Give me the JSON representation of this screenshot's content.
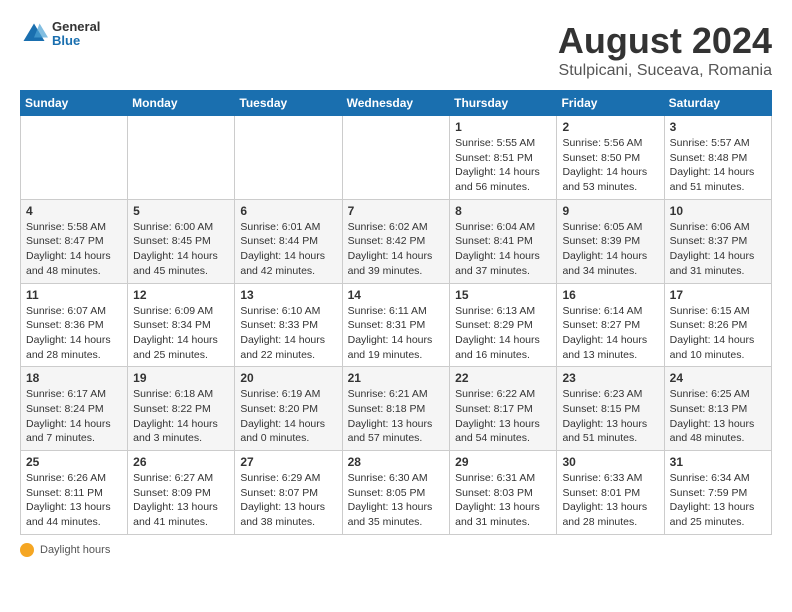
{
  "header": {
    "logo": {
      "general": "General",
      "blue": "Blue"
    },
    "title": "August 2024",
    "location": "Stulpicani, Suceava, Romania"
  },
  "calendar": {
    "weekdays": [
      "Sunday",
      "Monday",
      "Tuesday",
      "Wednesday",
      "Thursday",
      "Friday",
      "Saturday"
    ],
    "weeks": [
      [
        {
          "day": "",
          "info": ""
        },
        {
          "day": "",
          "info": ""
        },
        {
          "day": "",
          "info": ""
        },
        {
          "day": "",
          "info": ""
        },
        {
          "day": "1",
          "info": "Sunrise: 5:55 AM\nSunset: 8:51 PM\nDaylight: 14 hours and 56 minutes."
        },
        {
          "day": "2",
          "info": "Sunrise: 5:56 AM\nSunset: 8:50 PM\nDaylight: 14 hours and 53 minutes."
        },
        {
          "day": "3",
          "info": "Sunrise: 5:57 AM\nSunset: 8:48 PM\nDaylight: 14 hours and 51 minutes."
        }
      ],
      [
        {
          "day": "4",
          "info": "Sunrise: 5:58 AM\nSunset: 8:47 PM\nDaylight: 14 hours and 48 minutes."
        },
        {
          "day": "5",
          "info": "Sunrise: 6:00 AM\nSunset: 8:45 PM\nDaylight: 14 hours and 45 minutes."
        },
        {
          "day": "6",
          "info": "Sunrise: 6:01 AM\nSunset: 8:44 PM\nDaylight: 14 hours and 42 minutes."
        },
        {
          "day": "7",
          "info": "Sunrise: 6:02 AM\nSunset: 8:42 PM\nDaylight: 14 hours and 39 minutes."
        },
        {
          "day": "8",
          "info": "Sunrise: 6:04 AM\nSunset: 8:41 PM\nDaylight: 14 hours and 37 minutes."
        },
        {
          "day": "9",
          "info": "Sunrise: 6:05 AM\nSunset: 8:39 PM\nDaylight: 14 hours and 34 minutes."
        },
        {
          "day": "10",
          "info": "Sunrise: 6:06 AM\nSunset: 8:37 PM\nDaylight: 14 hours and 31 minutes."
        }
      ],
      [
        {
          "day": "11",
          "info": "Sunrise: 6:07 AM\nSunset: 8:36 PM\nDaylight: 14 hours and 28 minutes."
        },
        {
          "day": "12",
          "info": "Sunrise: 6:09 AM\nSunset: 8:34 PM\nDaylight: 14 hours and 25 minutes."
        },
        {
          "day": "13",
          "info": "Sunrise: 6:10 AM\nSunset: 8:33 PM\nDaylight: 14 hours and 22 minutes."
        },
        {
          "day": "14",
          "info": "Sunrise: 6:11 AM\nSunset: 8:31 PM\nDaylight: 14 hours and 19 minutes."
        },
        {
          "day": "15",
          "info": "Sunrise: 6:13 AM\nSunset: 8:29 PM\nDaylight: 14 hours and 16 minutes."
        },
        {
          "day": "16",
          "info": "Sunrise: 6:14 AM\nSunset: 8:27 PM\nDaylight: 14 hours and 13 minutes."
        },
        {
          "day": "17",
          "info": "Sunrise: 6:15 AM\nSunset: 8:26 PM\nDaylight: 14 hours and 10 minutes."
        }
      ],
      [
        {
          "day": "18",
          "info": "Sunrise: 6:17 AM\nSunset: 8:24 PM\nDaylight: 14 hours and 7 minutes."
        },
        {
          "day": "19",
          "info": "Sunrise: 6:18 AM\nSunset: 8:22 PM\nDaylight: 14 hours and 3 minutes."
        },
        {
          "day": "20",
          "info": "Sunrise: 6:19 AM\nSunset: 8:20 PM\nDaylight: 14 hours and 0 minutes."
        },
        {
          "day": "21",
          "info": "Sunrise: 6:21 AM\nSunset: 8:18 PM\nDaylight: 13 hours and 57 minutes."
        },
        {
          "day": "22",
          "info": "Sunrise: 6:22 AM\nSunset: 8:17 PM\nDaylight: 13 hours and 54 minutes."
        },
        {
          "day": "23",
          "info": "Sunrise: 6:23 AM\nSunset: 8:15 PM\nDaylight: 13 hours and 51 minutes."
        },
        {
          "day": "24",
          "info": "Sunrise: 6:25 AM\nSunset: 8:13 PM\nDaylight: 13 hours and 48 minutes."
        }
      ],
      [
        {
          "day": "25",
          "info": "Sunrise: 6:26 AM\nSunset: 8:11 PM\nDaylight: 13 hours and 44 minutes."
        },
        {
          "day": "26",
          "info": "Sunrise: 6:27 AM\nSunset: 8:09 PM\nDaylight: 13 hours and 41 minutes."
        },
        {
          "day": "27",
          "info": "Sunrise: 6:29 AM\nSunset: 8:07 PM\nDaylight: 13 hours and 38 minutes."
        },
        {
          "day": "28",
          "info": "Sunrise: 6:30 AM\nSunset: 8:05 PM\nDaylight: 13 hours and 35 minutes."
        },
        {
          "day": "29",
          "info": "Sunrise: 6:31 AM\nSunset: 8:03 PM\nDaylight: 13 hours and 31 minutes."
        },
        {
          "day": "30",
          "info": "Sunrise: 6:33 AM\nSunset: 8:01 PM\nDaylight: 13 hours and 28 minutes."
        },
        {
          "day": "31",
          "info": "Sunrise: 6:34 AM\nSunset: 7:59 PM\nDaylight: 13 hours and 25 minutes."
        }
      ]
    ]
  },
  "footer": {
    "note": "Daylight hours"
  }
}
